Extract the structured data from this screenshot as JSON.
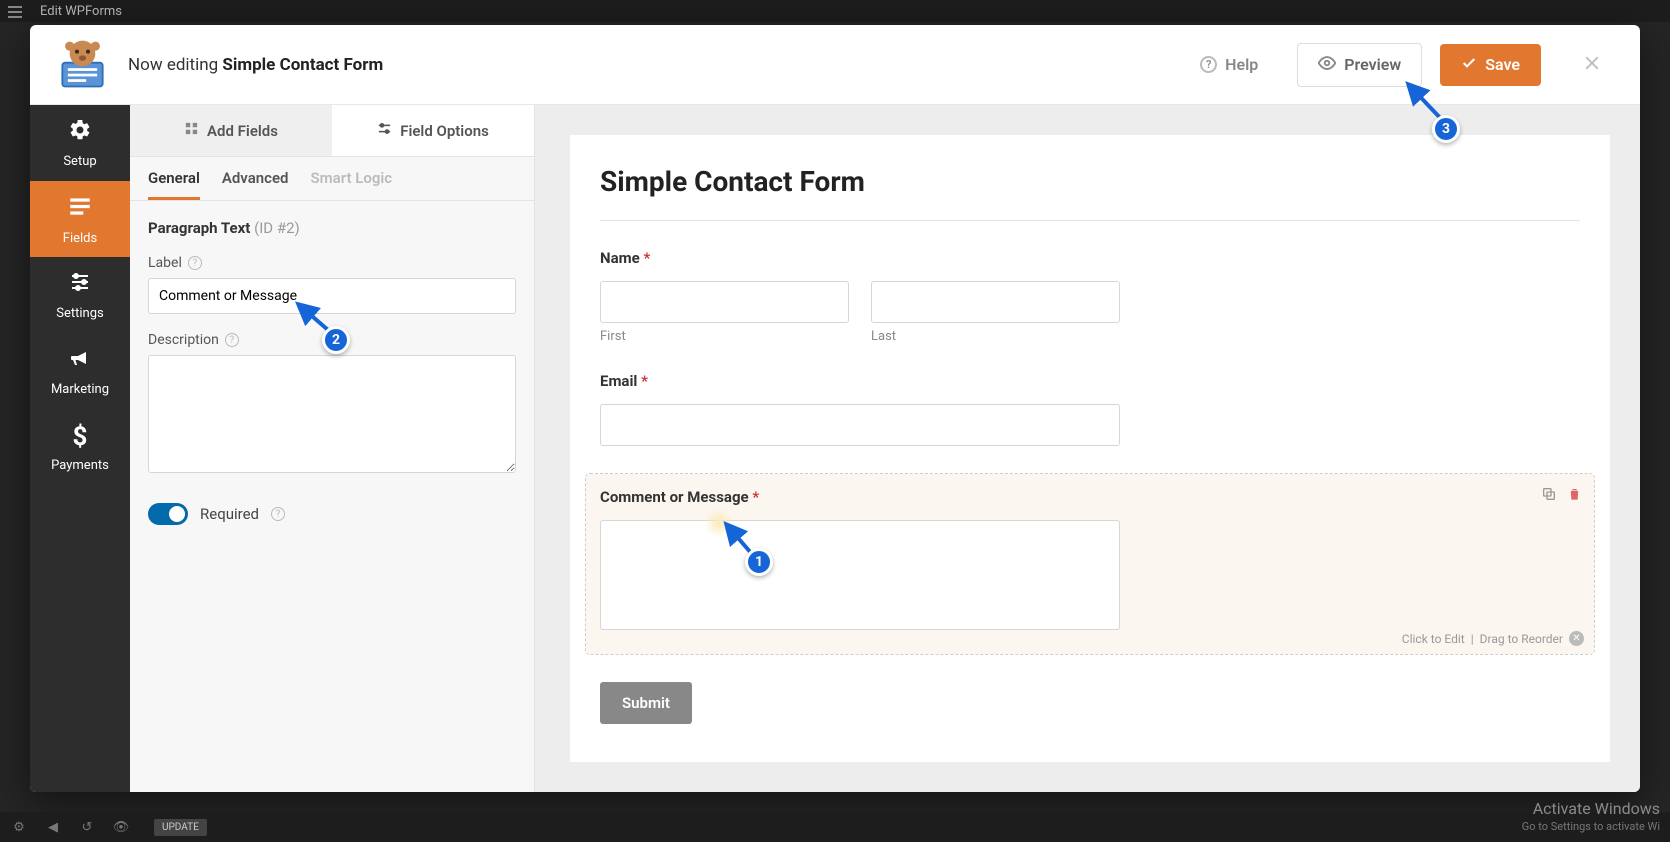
{
  "wp": {
    "topbar_title": "Edit WPForms",
    "update_label": "UPDATE"
  },
  "header": {
    "now_editing_prefix": "Now editing ",
    "form_name": "Simple Contact Form",
    "help_label": "Help",
    "preview_label": "Preview",
    "save_label": "Save"
  },
  "nav": {
    "setup": "Setup",
    "fields": "Fields",
    "settings": "Settings",
    "marketing": "Marketing",
    "payments": "Payments"
  },
  "panel": {
    "tab_add_fields": "Add Fields",
    "tab_field_options": "Field Options",
    "sub_general": "General",
    "sub_advanced": "Advanced",
    "sub_smart_logic": "Smart Logic",
    "field_type": "Paragraph Text",
    "field_id_label": "(ID #2)",
    "label_lbl": "Label",
    "label_value": "Comment or Message",
    "description_lbl": "Description",
    "description_value": "",
    "required_label": "Required"
  },
  "form": {
    "title": "Simple Contact Form",
    "name_label": "Name",
    "first_label": "First",
    "last_label": "Last",
    "email_label": "Email",
    "comment_label": "Comment or Message",
    "submit_label": "Submit",
    "hint_edit": "Click to Edit",
    "hint_drag": "Drag to Reorder"
  },
  "annotations": {
    "n1": "1",
    "n2": "2",
    "n3": "3"
  },
  "watermark": {
    "title": "Activate Windows",
    "sub": "Go to Settings to activate Wi"
  }
}
